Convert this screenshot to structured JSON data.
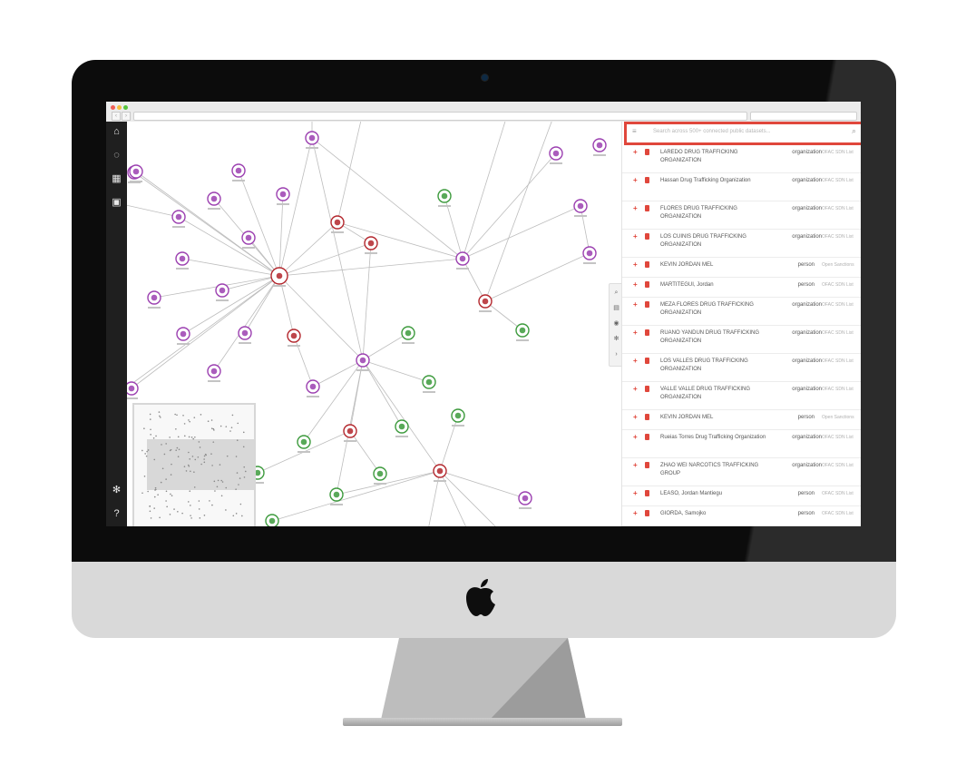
{
  "browser": {
    "url": ""
  },
  "nav": {
    "icons": [
      "home-icon",
      "history-icon",
      "dashboard-icon",
      "contacts-icon",
      "settings-icon",
      "help-icon"
    ]
  },
  "graph": {
    "tools": [
      "zoom-icon",
      "document-icon",
      "visibility-icon",
      "settings-icon",
      "collapse-icon"
    ]
  },
  "search": {
    "placeholder": "Search across 500+ connected public datasets..."
  },
  "results": [
    {
      "name": "LAREDO DRUG TRAFFICKING ORGANIZATION",
      "type": "organization",
      "source": "OFAC SDN List"
    },
    {
      "name": "Hassan Drug Trafficking Organization",
      "type": "organization",
      "source": "OFAC SDN List"
    },
    {
      "name": "FLORES DRUG TRAFFICKING ORGANIZATION",
      "type": "organization",
      "source": "OFAC SDN List"
    },
    {
      "name": "LOS CUINIS DRUG TRAFFICKING ORGANIZATION",
      "type": "organization",
      "source": "OFAC SDN List"
    },
    {
      "name": "KEVIN JORDAN MEL",
      "type": "person",
      "source": "Open Sanctions"
    },
    {
      "name": "MARTITEGUI, Jordan",
      "type": "person",
      "source": "OFAC SDN List"
    },
    {
      "name": "MEZA FLORES DRUG TRAFFICKING ORGANIZATION",
      "type": "organization",
      "source": "OFAC SDN List"
    },
    {
      "name": "RUANO YANDUN DRUG TRAFFICKING ORGANIZATION",
      "type": "organization",
      "source": "OFAC SDN List"
    },
    {
      "name": "LOS VALLES DRUG TRAFFICKING ORGANIZATION",
      "type": "organization",
      "source": "OFAC SDN List"
    },
    {
      "name": "VALLE VALLE DRUG TRAFFICKING ORGANIZATION",
      "type": "organization",
      "source": "OFAC SDN List"
    },
    {
      "name": "KEVIN JORDAN MEL",
      "type": "person",
      "source": "Open Sanctions"
    },
    {
      "name": "Rueias Torres Drug Trafficking Organization",
      "type": "organization",
      "source": "OFAC SDN List"
    },
    {
      "name": "ZHAO WEI NARCOTICS TRAFFICKING GROUP",
      "type": "organization",
      "source": "OFAC SDN List"
    },
    {
      "name": "LEASO, Jordan Mantiegu",
      "type": "person",
      "source": "OFAC SDN List"
    },
    {
      "name": "GIORDA, Samojko",
      "type": "person",
      "source": "OFAC SDN List"
    }
  ],
  "colors": {
    "accent": "#e0473c",
    "person": "#9b3fb0",
    "organization": "#b3262c",
    "company": "#3c9a3c",
    "sidebar": "#1f1f1f"
  }
}
